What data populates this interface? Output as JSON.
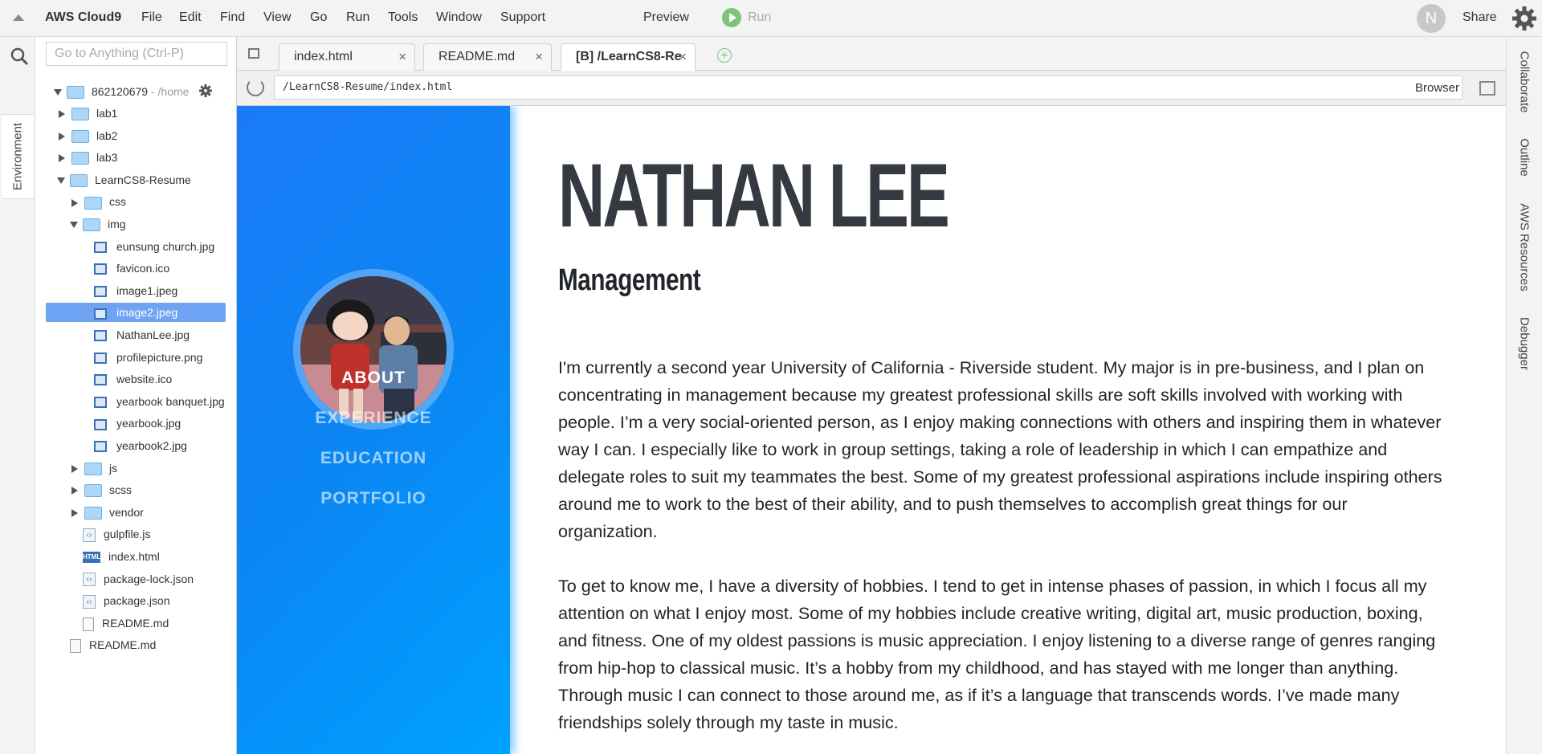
{
  "menubar": {
    "brand": "AWS Cloud9",
    "items": [
      "File",
      "Edit",
      "Find",
      "View",
      "Go",
      "Run",
      "Tools",
      "Window",
      "Support"
    ],
    "preview": "Preview",
    "run": "Run",
    "avatar_letter": "N",
    "share": "Share"
  },
  "left_strip": {
    "environment_tab": "Environment"
  },
  "file_panel": {
    "goto_placeholder": "Go to Anything (Ctrl-P)",
    "root_name": "862120679",
    "root_path": "- /home",
    "tree": [
      {
        "label": "lab1",
        "type": "folder",
        "state": "closed"
      },
      {
        "label": "lab2",
        "type": "folder",
        "state": "closed"
      },
      {
        "label": "lab3",
        "type": "folder",
        "state": "closed"
      },
      {
        "label": "LearnCS8-Resume",
        "type": "folder",
        "state": "open"
      },
      {
        "label": "css",
        "type": "folder",
        "state": "closed"
      },
      {
        "label": "img",
        "type": "folder",
        "state": "open"
      },
      {
        "label": "eunsung church.jpg",
        "type": "image"
      },
      {
        "label": "favicon.ico",
        "type": "image"
      },
      {
        "label": "image1.jpeg",
        "type": "image"
      },
      {
        "label": "image2.jpeg",
        "type": "image",
        "selected": true
      },
      {
        "label": "NathanLee.jpg",
        "type": "image"
      },
      {
        "label": "profilepicture.png",
        "type": "image"
      },
      {
        "label": "website.ico",
        "type": "image"
      },
      {
        "label": "yearbook banquet.jpg",
        "type": "image"
      },
      {
        "label": "yearbook.jpg",
        "type": "image"
      },
      {
        "label": "yearbook2.jpg",
        "type": "image"
      },
      {
        "label": "js",
        "type": "folder",
        "state": "closed"
      },
      {
        "label": "scss",
        "type": "folder",
        "state": "closed"
      },
      {
        "label": "vendor",
        "type": "folder",
        "state": "closed"
      },
      {
        "label": "gulpfile.js",
        "type": "js"
      },
      {
        "label": "index.html",
        "type": "html"
      },
      {
        "label": "package-lock.json",
        "type": "js"
      },
      {
        "label": "package.json",
        "type": "js"
      },
      {
        "label": "README.md",
        "type": "doc"
      },
      {
        "label": "README.md",
        "type": "doc"
      }
    ]
  },
  "tabs": [
    {
      "label": "index.html",
      "close": "×"
    },
    {
      "label": "README.md",
      "close": "×"
    },
    {
      "label": "[B] /LearnCS8-Re",
      "close": "×",
      "active": true
    }
  ],
  "new_tab": "+",
  "urlbar": {
    "url": "/LearnCS8-Resume/index.html",
    "browser": "Browser ▾"
  },
  "right_strip": [
    "Collaborate",
    "Outline",
    "AWS Resources",
    "Debugger"
  ],
  "resume": {
    "name": "NATHAN LEE",
    "subtitle": "Management",
    "nav": [
      "ABOUT",
      "EXPERIENCE",
      "EDUCATION",
      "PORTFOLIO"
    ],
    "paragraph1": "I'm currently a second year University of California - Riverside student. My major is in pre-business, and I plan on concentrating in management because my greatest professional skills are soft skills involved with working with people. I’m a very social-oriented person, as I enjoy making connections with others and inspiring them in whatever way I can. I especially like to work in group settings, taking a role of leadership in which I can empathize and delegate roles to suit my teammates the best. Some of my greatest professional aspirations include inspiring others around me to work to the best of their ability, and to push themselves to accomplish great things for our organization.",
    "paragraph2": "To get to know me, I have a diversity of hobbies. I tend to get in intense phases of passion, in which I focus all my attention on what I enjoy most. Some of my hobbies include creative writing, digital art, music production, boxing, and fitness. One of my oldest passions is music appreciation. I enjoy listening to a diverse range of genres ranging from hip-hop to classical music. It’s a hobby from my childhood, and has stayed with me longer than anything. Through music I can connect to those around me, as if it’s a language that transcends words. I’ve made many friendships solely through my taste in music."
  }
}
